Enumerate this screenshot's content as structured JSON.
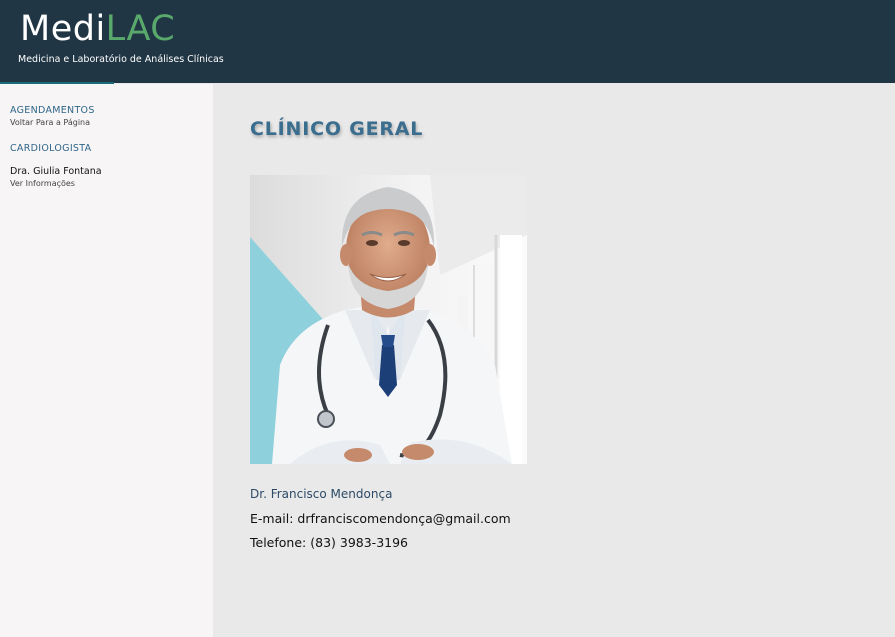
{
  "header": {
    "logo_part1": "Medi",
    "logo_part2": "LAC",
    "tagline": "Medicina e Laboratório de Análises Clínicas"
  },
  "sidebar": {
    "items": [
      {
        "heading": "AGENDAMENTOS",
        "sub": "Voltar Para a Página"
      },
      {
        "heading": "CARDIOLOGISTA",
        "name": "Dra. Giulia Fontana",
        "sub": "Ver Informações"
      }
    ]
  },
  "main": {
    "title": "CLÍNICO GERAL",
    "doctor_name": "Dr. Francisco Mendonça",
    "email_label": "E-mail:",
    "email": "drfranciscomendonça@gmail.com",
    "phone_label": "Telefone:",
    "phone": "(83) 3983-3196"
  },
  "colors": {
    "header_bg": "#213644",
    "logo_accent": "#5aa96c",
    "nav_heading": "#2f6688",
    "title": "#3a6d8e",
    "sidebar_bg": "#f7f5f6",
    "main_bg": "#e9e9e9"
  }
}
